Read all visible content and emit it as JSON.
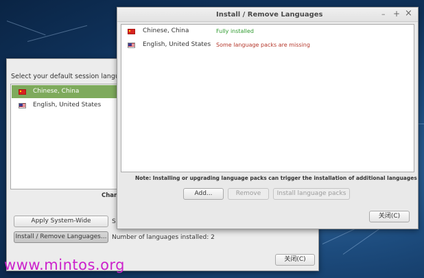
{
  "back_window": {
    "prompt": "Select your default session language",
    "languages": [
      {
        "flag": "china-flag",
        "name": "Chinese, China"
      },
      {
        "flag": "us-flag",
        "name": "English, United States"
      }
    ],
    "partial_label": "Chang",
    "apply_button": "Apply System-Wide",
    "apply_suffix": "S",
    "install_button": "Install / Remove Languages...",
    "installed_count": "Number of languages installed: 2",
    "close_button": "关闭(C)"
  },
  "front_window": {
    "title": "Install / Remove Languages",
    "controls": {
      "minimize": "–",
      "maximize": "+",
      "close": "×"
    },
    "languages": [
      {
        "flag": "china-flag",
        "name": "Chinese, China",
        "status": "Fully installed",
        "status_color": "#2e9a2e"
      },
      {
        "flag": "us-flag",
        "name": "English, United States",
        "status": "Some language packs are missing",
        "status_color": "#b5372b"
      }
    ],
    "note": "Note: Installing or upgrading language packs can trigger the installation of additional languages",
    "add_button": "Add...",
    "remove_button": "Remove",
    "install_packs_button": "Install language packs",
    "close_button": "关闭(C)"
  },
  "watermark": "www.mintos.org"
}
